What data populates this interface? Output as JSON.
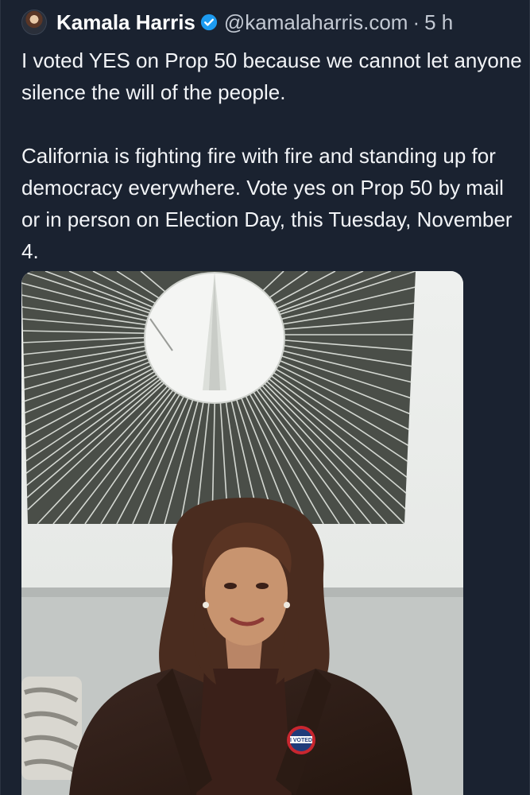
{
  "author": {
    "display_name": "Kamala Harris",
    "handle": "@kamalaharris.com",
    "separator": "·",
    "time": "5 h",
    "avatar_icon": "profile-avatar",
    "verified_icon": "verified-badge-icon",
    "verified_color": "#1d9bf0"
  },
  "post": {
    "paragraph_1": "I voted YES on Prop 50 because we cannot let anyone silence the will of the people.",
    "paragraph_2": "California is fighting fire with fire and standing up for democracy everywhere. Vote yes on Prop 50 by mail or in person on Election Day, this Tuesday, November 4."
  },
  "media": {
    "sticker_text": "I VOTED"
  },
  "colors": {
    "background": "#1a2230",
    "text": "#f2f4f7",
    "muted": "#c3c9d3"
  }
}
